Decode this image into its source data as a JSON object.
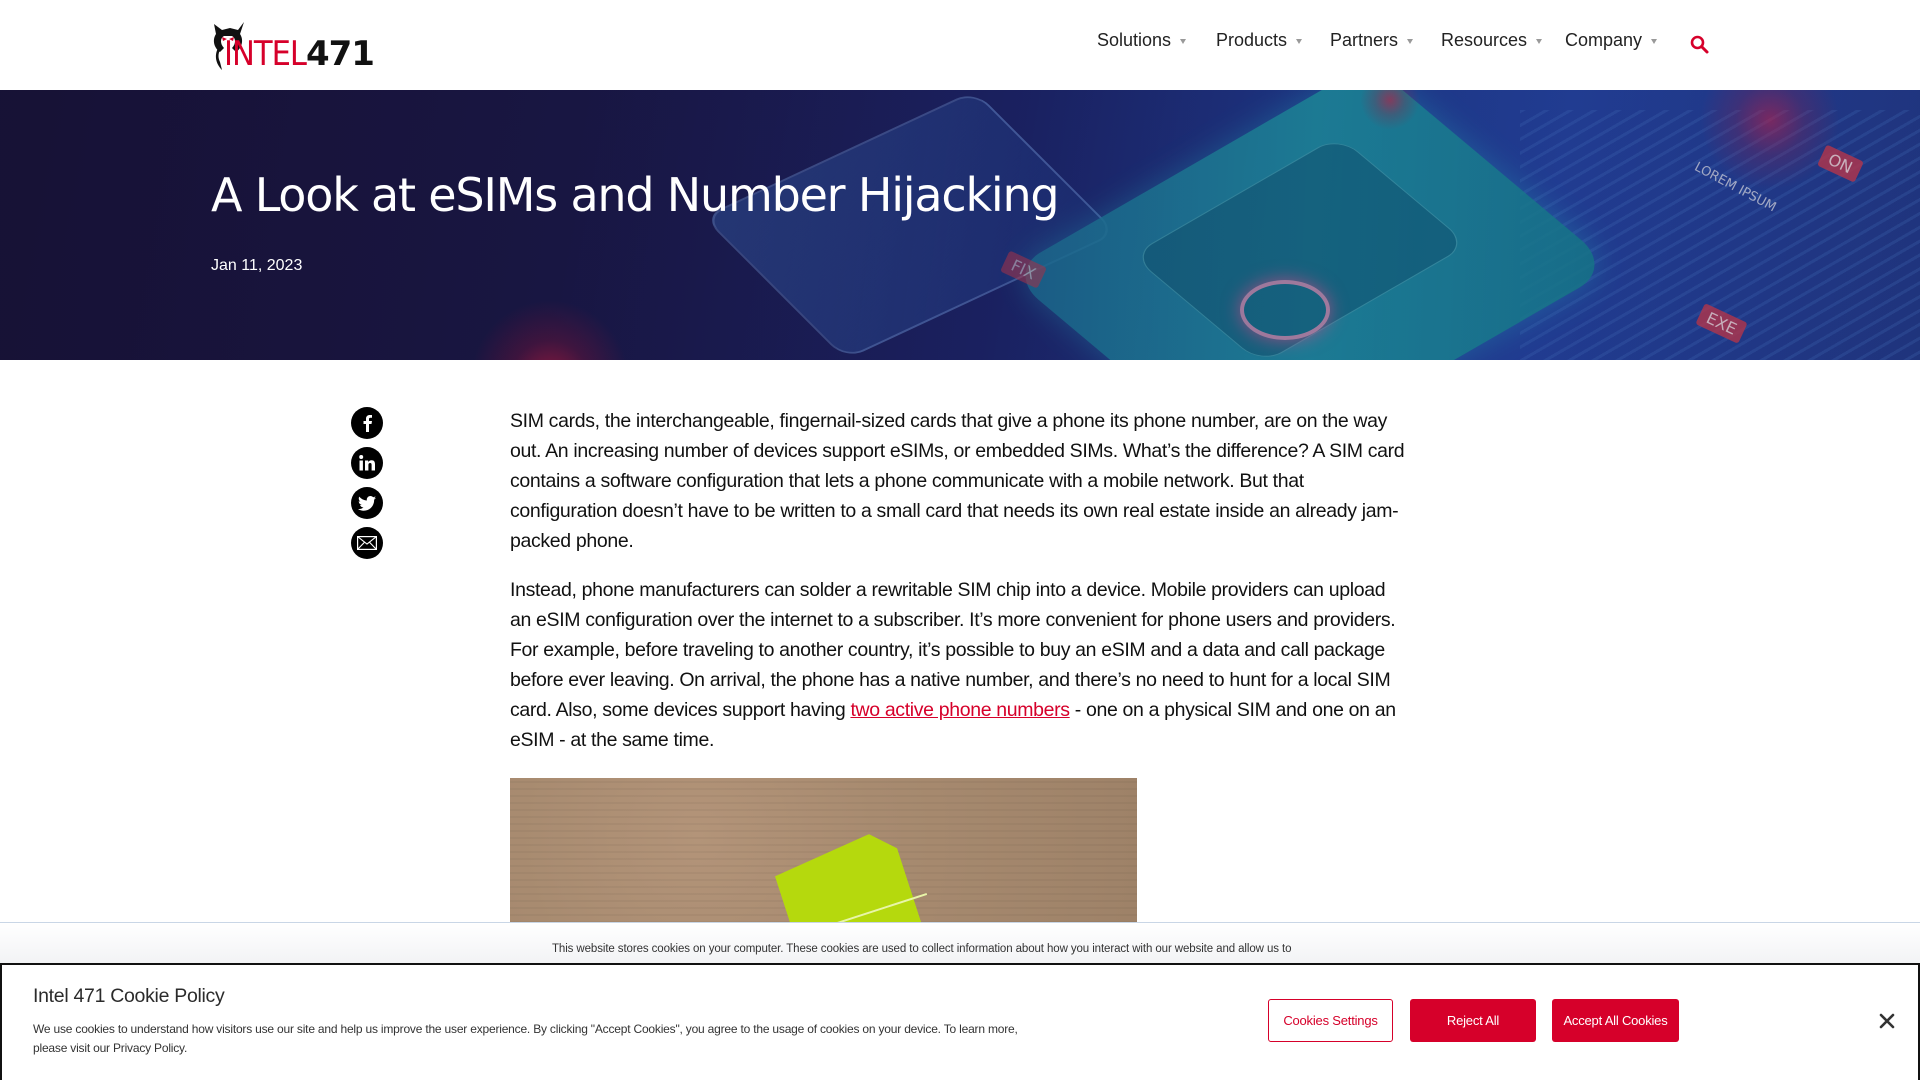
{
  "brand": {
    "name": "Intel 471",
    "logo_text_red": "INTEL",
    "logo_text_black": "471",
    "accent_color": "#d6002a"
  },
  "nav": {
    "items": [
      {
        "label": "Solutions"
      },
      {
        "label": "Products"
      },
      {
        "label": "Partners"
      },
      {
        "label": "Resources"
      },
      {
        "label": "Company"
      }
    ],
    "search_icon": "search-icon"
  },
  "hero": {
    "title": "A Look at eSIMs and Number Hijacking",
    "date": "Jan 11, 2023",
    "image_labels": [
      "LOREM IPSUM",
      "ON",
      "EXE",
      "FIX"
    ]
  },
  "share": {
    "icons": [
      "facebook-icon",
      "linkedin-icon",
      "twitter-icon",
      "email-icon"
    ]
  },
  "article": {
    "paragraph1": "SIM cards, the interchangeable, fingernail-sized cards that give a phone its phone number, are on the way out. An increasing number of devices support eSIMs, or embedded SIMs. What’s the difference? A SIM card contains a software configuration that lets a phone communicate with a mobile network. But that configuration doesn’t have to be written to a small card that needs its own real estate inside an already jam-packed phone.",
    "paragraph2_before": "Instead, phone manufacturers can solder a rewritable SIM chip into a device. Mobile providers can upload an eSIM configuration over the internet to a subscriber. It’s more convenient for phone users and providers. For example, before traveling to another country, it’s possible to buy an eSIM and a data and call package before ever leaving. On arrival, the phone has a native number, and there’s no need to hunt for a local SIM card. Also, some devices support having ",
    "paragraph2_link": "two active phone numbers",
    "paragraph2_after": " - one on a physical SIM and one on an eSIM - at the same time."
  },
  "cookie_notice": {
    "strip_text": "This website stores cookies on your computer. These cookies are used to collect information about how you interact with our website and allow us to",
    "title": "Intel 471 Cookie Policy",
    "body": "We use cookies to understand how visitors use our site and help us improve the user experience. By clicking \"Accept Cookies\", you agree to the usage of cookies on your device. To learn more, please visit our Privacy Policy.",
    "buttons": {
      "settings": "Cookies Settings",
      "reject": "Reject All",
      "accept": "Accept All Cookies"
    },
    "close_icon": "close-icon"
  }
}
